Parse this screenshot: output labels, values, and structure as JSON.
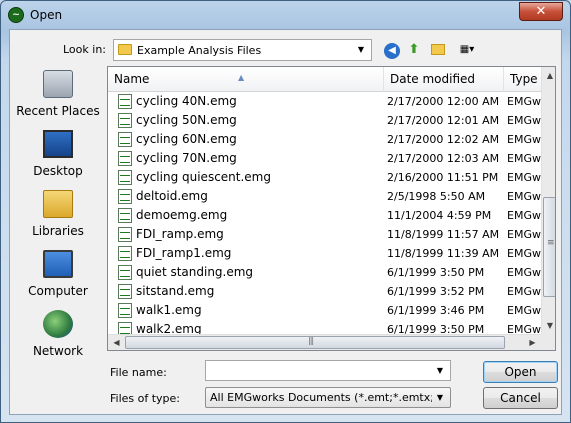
{
  "window": {
    "title": "Open",
    "close_glyph": "✕",
    "app_icon": "emg-app-icon"
  },
  "lookin": {
    "label": "Look in:",
    "folder": "Example Analysis Files"
  },
  "places": [
    {
      "label": "Recent Places",
      "icon": "recent-places-icon"
    },
    {
      "label": "Desktop",
      "icon": "desktop-icon"
    },
    {
      "label": "Libraries",
      "icon": "libraries-icon"
    },
    {
      "label": "Computer",
      "icon": "computer-icon"
    },
    {
      "label": "Network",
      "icon": "network-icon"
    }
  ],
  "columns": {
    "name": "Name",
    "date": "Date modified",
    "type": "Type"
  },
  "files": [
    {
      "name": "cycling 40N.emg",
      "date": "2/17/2000 12:00 AM",
      "type": "EMGw"
    },
    {
      "name": "cycling 50N.emg",
      "date": "2/17/2000 12:01 AM",
      "type": "EMGw"
    },
    {
      "name": "cycling 60N.emg",
      "date": "2/17/2000 12:02 AM",
      "type": "EMGw"
    },
    {
      "name": "cycling 70N.emg",
      "date": "2/17/2000 12:03 AM",
      "type": "EMGw"
    },
    {
      "name": "cycling quiescent.emg",
      "date": "2/16/2000 11:51 PM",
      "type": "EMGw"
    },
    {
      "name": "deltoid.emg",
      "date": "2/5/1998 5:50 AM",
      "type": "EMGw"
    },
    {
      "name": "demoemg.emg",
      "date": "11/1/2004 4:59 PM",
      "type": "EMGw"
    },
    {
      "name": "FDI_ramp.emg",
      "date": "11/8/1999 11:57 AM",
      "type": "EMGw"
    },
    {
      "name": "FDI_ramp1.emg",
      "date": "11/8/1999 11:39 AM",
      "type": "EMGw"
    },
    {
      "name": "quiet standing.emg",
      "date": "6/1/1999 3:50 PM",
      "type": "EMGw"
    },
    {
      "name": "sitstand.emg",
      "date": "6/1/1999 3:52 PM",
      "type": "EMGw"
    },
    {
      "name": "walk1.emg",
      "date": "6/1/1999 3:46 PM",
      "type": "EMGw"
    },
    {
      "name": "walk2.emg",
      "date": "6/1/1999 3:50 PM",
      "type": "EMGw"
    }
  ],
  "filename": {
    "label": "File name:",
    "value": ""
  },
  "filetype": {
    "label": "Files of type:",
    "value": "All EMGworks Documents (*.emt;*.emtx;*.emg;*.emgx)"
  },
  "buttons": {
    "open": "Open",
    "cancel": "Cancel"
  }
}
